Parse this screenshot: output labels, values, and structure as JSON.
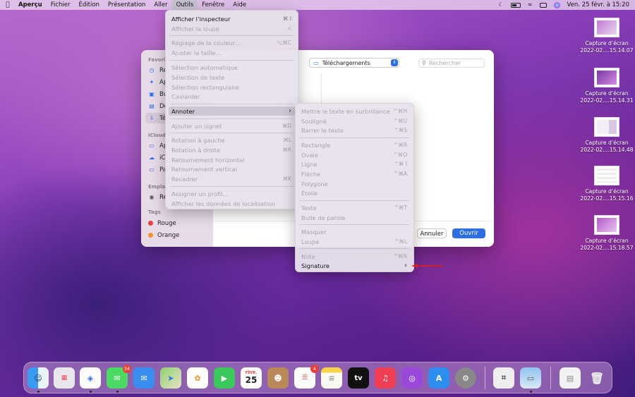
{
  "menubar": {
    "app": "Aperçu",
    "items": [
      "Fichier",
      "Édition",
      "Présentation",
      "Aller",
      "Outils",
      "Fenêtre",
      "Aide"
    ],
    "active": "Outils",
    "clock": "Ven. 25 févr. à  15:20"
  },
  "desktop_icons": [
    {
      "line1": "Capture d’écran",
      "line2": "2022-02....15.14.07"
    },
    {
      "line1": "Capture d’écran",
      "line2": "2022-02....15.14.31"
    },
    {
      "line1": "Capture d’écran",
      "line2": "2022-02....15.14.48"
    },
    {
      "line1": "Capture d’écran",
      "line2": "2022-02....15.15.16"
    },
    {
      "line1": "Capture d’écran",
      "line2": "2022-02....15.18.57"
    }
  ],
  "dialog": {
    "location": "Téléchargements",
    "search_placeholder": "Rechercher",
    "cancel": "Annuler",
    "open": "Ouvrir",
    "sidebar": {
      "favorites_header": "Favoris",
      "favorites": [
        "Ré",
        "Ap",
        "Bu",
        "Do",
        "Té"
      ],
      "icloud_header": "iCloud",
      "icloud": [
        "Ap",
        "iC",
        "Pa"
      ],
      "locations_header": "Emplac",
      "locations": [
        "Ré"
      ],
      "tags_header": "Tags",
      "tags": [
        {
          "label": "Rouge",
          "color": "#e8403a"
        },
        {
          "label": "Orange",
          "color": "#f0932b"
        }
      ]
    }
  },
  "tools_menu": {
    "items": [
      {
        "label": "Afficher l’inspecteur",
        "shortcut": "⌘ I",
        "enabled": true
      },
      {
        "label": "Afficher la loupe",
        "shortcut": "<",
        "enabled": false
      },
      {
        "label": "Réglage de la couleur…",
        "shortcut": "⌥⌘C",
        "enabled": false
      },
      {
        "label": "Ajuster la taille…",
        "shortcut": "",
        "enabled": false
      },
      {
        "label": "Sélection automatique",
        "shortcut": "",
        "enabled": false
      },
      {
        "label": "Sélection de texte",
        "shortcut": "",
        "enabled": false
      },
      {
        "label": "Sélection rectangulaire",
        "shortcut": "",
        "enabled": false
      },
      {
        "label": "Caviarder",
        "shortcut": "",
        "enabled": false
      },
      {
        "label": "Annoter",
        "shortcut": "›",
        "enabled": true
      },
      {
        "label": "Ajouter un signet",
        "shortcut": "⌘D",
        "enabled": false
      },
      {
        "label": "Rotation à gauche",
        "shortcut": "⌘L",
        "enabled": false
      },
      {
        "label": "Rotation à droite",
        "shortcut": "⌘R",
        "enabled": false
      },
      {
        "label": "Retournement horizontal",
        "shortcut": "",
        "enabled": false
      },
      {
        "label": "Retournement vertical",
        "shortcut": "",
        "enabled": false
      },
      {
        "label": "Recadrer",
        "shortcut": "⌘K",
        "enabled": false
      },
      {
        "label": "Assigner un profil…",
        "shortcut": "",
        "enabled": false
      },
      {
        "label": "Afficher les données de localisation",
        "shortcut": "",
        "enabled": false
      }
    ]
  },
  "annotate_menu": {
    "items": [
      {
        "label": "Mettre le texte en surbrillance",
        "shortcut": "^⌘H",
        "enabled": false
      },
      {
        "label": "Souligné",
        "shortcut": "^⌘U",
        "enabled": false
      },
      {
        "label": "Barrer le texte",
        "shortcut": "^⌘S",
        "enabled": false
      },
      {
        "label": "Rectangle",
        "shortcut": "^⌘R",
        "enabled": false
      },
      {
        "label": "Ovale",
        "shortcut": "^⌘O",
        "enabled": false
      },
      {
        "label": "Ligne",
        "shortcut": "^⌘ I",
        "enabled": false
      },
      {
        "label": "Flèche",
        "shortcut": "^⌘A",
        "enabled": false
      },
      {
        "label": "Polygone",
        "shortcut": "",
        "enabled": false
      },
      {
        "label": "Étoile",
        "shortcut": "",
        "enabled": false
      },
      {
        "label": "Texte",
        "shortcut": "^⌘T",
        "enabled": false
      },
      {
        "label": "Bulle de parole",
        "shortcut": "",
        "enabled": false
      },
      {
        "label": "Masquer",
        "shortcut": "",
        "enabled": false
      },
      {
        "label": "Loupe",
        "shortcut": "^⌘L",
        "enabled": false
      },
      {
        "label": "Note",
        "shortcut": "^⌘N",
        "enabled": false
      },
      {
        "label": "Signature",
        "shortcut": "›",
        "enabled": true
      }
    ]
  },
  "dock": {
    "messages_badge": "34",
    "reminders_badge": "4",
    "calendar_month": "FÉVR.",
    "calendar_day": "25",
    "tv_label": "tv"
  },
  "colors": {
    "accent": "#2d6ee0",
    "arrow": "#d0202a"
  }
}
